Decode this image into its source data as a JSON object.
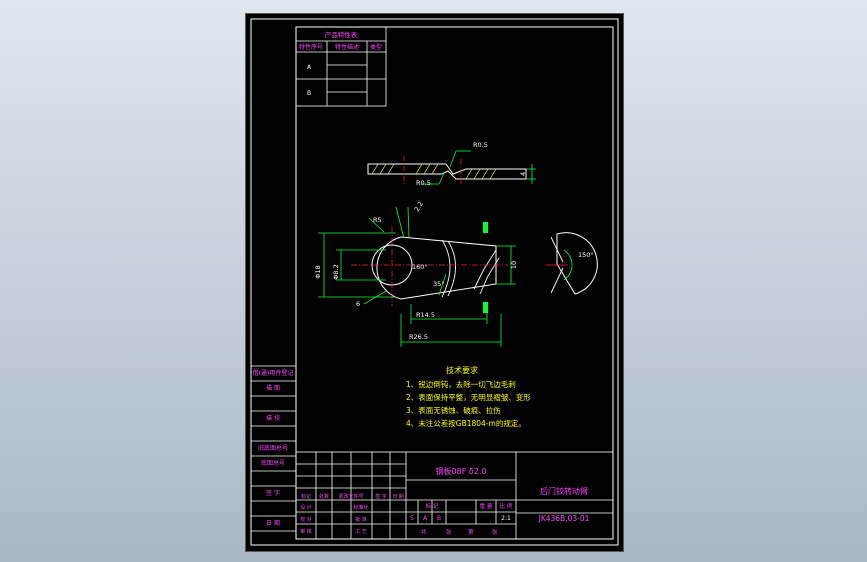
{
  "drawing": {
    "surface_table": {
      "title": "产品特性表",
      "headers": [
        "特性序号",
        "特性描述",
        "类型"
      ],
      "rows": [
        "A",
        "B"
      ]
    },
    "dimensions": {
      "r05_top": "R0.5",
      "r05_bottom": "R0.5",
      "thickness": "4",
      "r5": "R5",
      "r22": "2.2",
      "dia_outer": "Φ18",
      "dia_inner": "Φ8.2",
      "dia6": "6",
      "angle_160": "160°",
      "angle_35": "35°",
      "height_10": "10",
      "r145": "R14.5",
      "r265": "R26.5",
      "angle_150": "150°"
    },
    "tech_notes": {
      "title": "技术要求",
      "items": [
        "1、锐边倒钝，去除一切飞边毛刺",
        "2、表面保持平整，无明显褶皱、变形",
        "3、表面无锈蚀、破痕、拉伤",
        "4、未注公差按GB1804-m的规定。"
      ]
    },
    "left_strip": [
      "借(通)用件登记",
      "旧底图总号",
      "底图总号",
      "签 字",
      "日 期"
    ],
    "left_strip_short": [
      "描 图",
      "描 校"
    ],
    "title_block": {
      "material": "钢板08F δ2.0",
      "part_name": "后门铰转动臂",
      "drawing_no": "JK436B.03-01",
      "scale": "2:1",
      "mark_labels": [
        "标 记",
        "重 量",
        "比 例"
      ],
      "stage_letters": [
        "S",
        "A",
        "B"
      ],
      "sheet_labels": [
        "共",
        "张",
        "第",
        "张"
      ],
      "change_headers": [
        "标记",
        "处数",
        "更改文件号",
        "签 字",
        "日 期"
      ],
      "sign_roles": [
        "设 计",
        "校 对",
        "审 核",
        "标准化",
        "批 准",
        "工 艺"
      ]
    }
  }
}
